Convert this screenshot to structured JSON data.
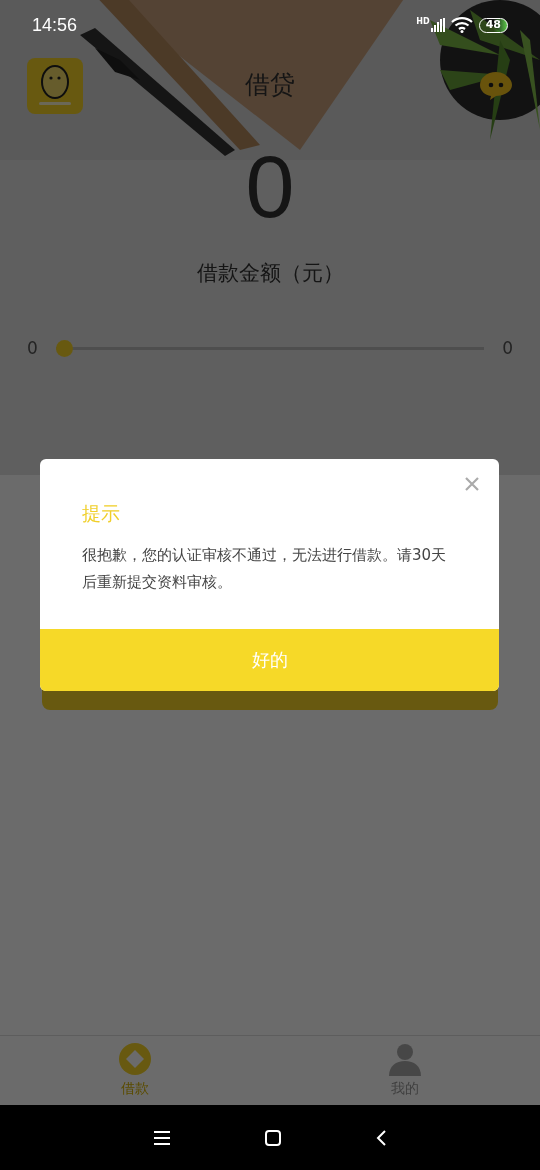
{
  "status_bar": {
    "time": "14:56",
    "network": "HD",
    "battery": "48"
  },
  "header": {
    "title": "借贷"
  },
  "loan": {
    "amount": "0",
    "label": "借款金额（元）",
    "slider": {
      "min_label": "0",
      "max_label": "0",
      "level": 0
    }
  },
  "dialog": {
    "title": "提示",
    "message": "很抱歉，您的认证审核不通过，无法进行借款。请30天后重新提交资料审核。",
    "confirm": "好的"
  },
  "tabs": [
    {
      "label": "借款",
      "selected": true
    },
    {
      "label": "我的",
      "selected": false
    }
  ]
}
